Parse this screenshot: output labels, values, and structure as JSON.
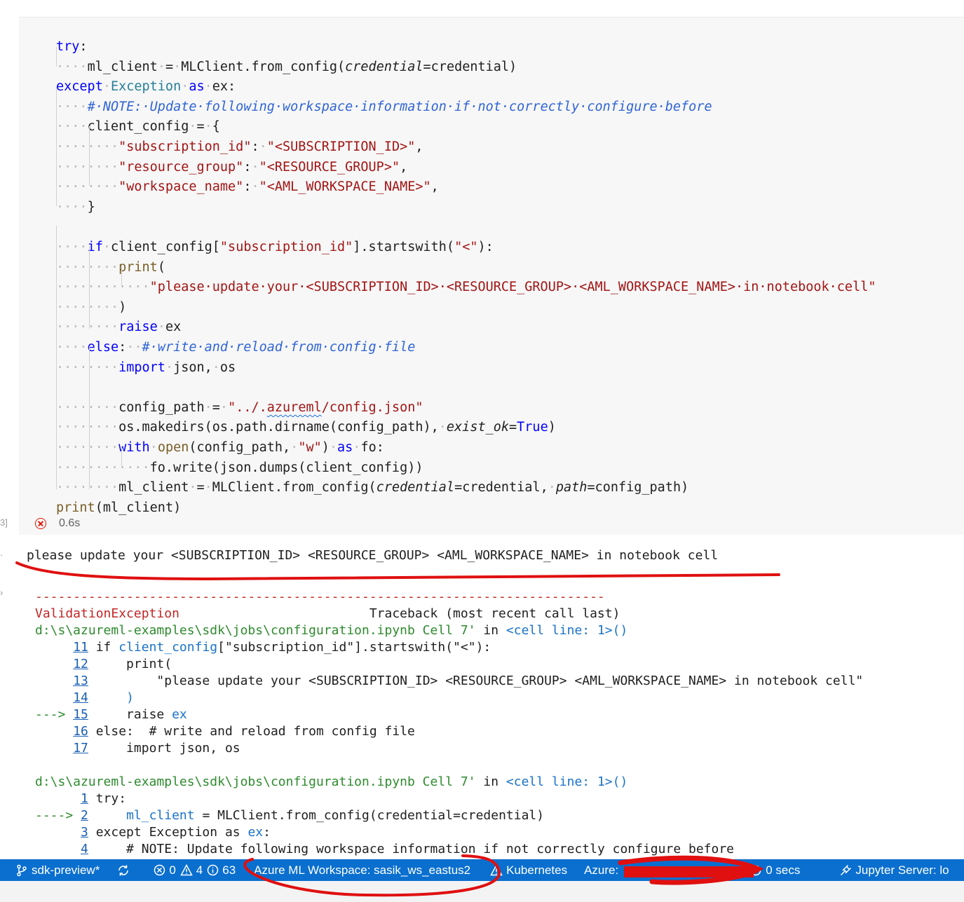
{
  "code_lines": [
    [
      {
        "t": "try",
        "c": "kw"
      },
      {
        "t": ":",
        "c": ""
      }
    ],
    [
      {
        "t": "····",
        "c": "dot"
      },
      {
        "t": "ml_client",
        "c": ""
      },
      {
        "t": "·",
        "c": "dot"
      },
      {
        "t": "=",
        "c": ""
      },
      {
        "t": "·",
        "c": "dot"
      },
      {
        "t": "MLClient.from_config(",
        "c": ""
      },
      {
        "t": "credential",
        "c": "param"
      },
      {
        "t": "=credential)",
        "c": ""
      }
    ],
    [
      {
        "t": "except",
        "c": "kw"
      },
      {
        "t": "·",
        "c": "dot"
      },
      {
        "t": "Exception",
        "c": "cls"
      },
      {
        "t": "·",
        "c": "dot"
      },
      {
        "t": "as",
        "c": "kw"
      },
      {
        "t": "·",
        "c": "dot"
      },
      {
        "t": "ex:",
        "c": ""
      }
    ],
    [
      {
        "t": "····",
        "c": "dot"
      },
      {
        "t": "#·NOTE:·Update·following·workspace·information·if·not·correctly·configure·before",
        "c": "cm"
      }
    ],
    [
      {
        "t": "····",
        "c": "dot"
      },
      {
        "t": "client_config",
        "c": ""
      },
      {
        "t": "·",
        "c": "dot"
      },
      {
        "t": "=",
        "c": ""
      },
      {
        "t": "·",
        "c": "dot"
      },
      {
        "t": "{",
        "c": ""
      }
    ],
    [
      {
        "t": "········",
        "c": "dot"
      },
      {
        "t": "\"subscription_id\"",
        "c": "str"
      },
      {
        "t": ":",
        "c": ""
      },
      {
        "t": "·",
        "c": "dot"
      },
      {
        "t": "\"<SUBSCRIPTION_ID>\"",
        "c": "str"
      },
      {
        "t": ",",
        "c": ""
      }
    ],
    [
      {
        "t": "········",
        "c": "dot"
      },
      {
        "t": "\"resource_group\"",
        "c": "str"
      },
      {
        "t": ":",
        "c": ""
      },
      {
        "t": "·",
        "c": "dot"
      },
      {
        "t": "\"<RESOURCE_GROUP>\"",
        "c": "str"
      },
      {
        "t": ",",
        "c": ""
      }
    ],
    [
      {
        "t": "········",
        "c": "dot"
      },
      {
        "t": "\"workspace_name\"",
        "c": "str"
      },
      {
        "t": ":",
        "c": ""
      },
      {
        "t": "·",
        "c": "dot"
      },
      {
        "t": "\"<AML_WORKSPACE_NAME>\"",
        "c": "str"
      },
      {
        "t": ",",
        "c": ""
      }
    ],
    [
      {
        "t": "····",
        "c": "dot"
      },
      {
        "t": "}",
        "c": ""
      }
    ],
    [],
    [
      {
        "t": "····",
        "c": "dot"
      },
      {
        "t": "if",
        "c": "kw"
      },
      {
        "t": "·",
        "c": "dot"
      },
      {
        "t": "client_config[",
        "c": ""
      },
      {
        "t": "\"subscription_id\"",
        "c": "str"
      },
      {
        "t": "].startswith(",
        "c": ""
      },
      {
        "t": "\"<\"",
        "c": "str"
      },
      {
        "t": "):",
        "c": ""
      }
    ],
    [
      {
        "t": "········",
        "c": "dot"
      },
      {
        "t": "print",
        "c": "fn"
      },
      {
        "t": "(",
        "c": ""
      }
    ],
    [
      {
        "t": "············",
        "c": "dot"
      },
      {
        "t": "\"please·update·your·<SUBSCRIPTION_ID>·<RESOURCE_GROUP>·<AML_WORKSPACE_NAME>·in·notebook·cell\"",
        "c": "str"
      }
    ],
    [
      {
        "t": "········",
        "c": "dot"
      },
      {
        "t": ")",
        "c": ""
      }
    ],
    [
      {
        "t": "········",
        "c": "dot"
      },
      {
        "t": "raise",
        "c": "kw"
      },
      {
        "t": "·",
        "c": "dot"
      },
      {
        "t": "ex",
        "c": ""
      }
    ],
    [
      {
        "t": "····",
        "c": "dot"
      },
      {
        "t": "else",
        "c": "kw"
      },
      {
        "t": ":",
        "c": ""
      },
      {
        "t": "··",
        "c": "dot"
      },
      {
        "t": "#·write·and·reload·from·config·file",
        "c": "cm"
      }
    ],
    [
      {
        "t": "········",
        "c": "dot"
      },
      {
        "t": "import",
        "c": "kw"
      },
      {
        "t": "·",
        "c": "dot"
      },
      {
        "t": "json,",
        "c": ""
      },
      {
        "t": "·",
        "c": "dot"
      },
      {
        "t": "os",
        "c": ""
      }
    ],
    [],
    [
      {
        "t": "········",
        "c": "dot"
      },
      {
        "t": "config_path",
        "c": ""
      },
      {
        "t": "·",
        "c": "dot"
      },
      {
        "t": "=",
        "c": ""
      },
      {
        "t": "·",
        "c": "dot"
      },
      {
        "t": "\"../.",
        "c": "str"
      },
      {
        "t": "azureml",
        "c": "str squig"
      },
      {
        "t": "/config.json\"",
        "c": "str"
      }
    ],
    [
      {
        "t": "········",
        "c": "dot"
      },
      {
        "t": "os.makedirs(os.path.dirname(config_path),",
        "c": ""
      },
      {
        "t": "·",
        "c": "dot"
      },
      {
        "t": "exist_ok",
        "c": "param"
      },
      {
        "t": "=",
        "c": ""
      },
      {
        "t": "True",
        "c": "kw"
      },
      {
        "t": ")",
        "c": ""
      }
    ],
    [
      {
        "t": "········",
        "c": "dot"
      },
      {
        "t": "with",
        "c": "kw"
      },
      {
        "t": "·",
        "c": "dot"
      },
      {
        "t": "open",
        "c": "fn"
      },
      {
        "t": "(config_path,",
        "c": ""
      },
      {
        "t": "·",
        "c": "dot"
      },
      {
        "t": "\"w\"",
        "c": "str"
      },
      {
        "t": ")",
        "c": ""
      },
      {
        "t": "·",
        "c": "dot"
      },
      {
        "t": "as",
        "c": "kw"
      },
      {
        "t": "·",
        "c": "dot"
      },
      {
        "t": "fo:",
        "c": ""
      }
    ],
    [
      {
        "t": "············",
        "c": "dot"
      },
      {
        "t": "fo.write(json.dumps(client_config))",
        "c": ""
      }
    ],
    [
      {
        "t": "········",
        "c": "dot"
      },
      {
        "t": "ml_client",
        "c": ""
      },
      {
        "t": "·",
        "c": "dot"
      },
      {
        "t": "=",
        "c": ""
      },
      {
        "t": "·",
        "c": "dot"
      },
      {
        "t": "MLClient.from_config(",
        "c": ""
      },
      {
        "t": "credential",
        "c": "param"
      },
      {
        "t": "=credential,",
        "c": ""
      },
      {
        "t": "·",
        "c": "dot"
      },
      {
        "t": "path",
        "c": "param"
      },
      {
        "t": "=config_path)",
        "c": ""
      }
    ],
    [
      {
        "t": "print",
        "c": "fn"
      },
      {
        "t": "(ml_client)",
        "c": ""
      }
    ]
  ],
  "exec": {
    "bracket": "3]",
    "duration": "0.6s"
  },
  "output": {
    "stdout": "please update your <SUBSCRIPTION_ID> <RESOURCE_GROUP> <AML_WORKSPACE_NAME> in notebook cell",
    "dashes": "---------------------------------------------------------------------------"
  },
  "traceback": [
    [
      {
        "t": "ValidationException",
        "c": "red"
      },
      {
        "t": "                         Traceback (most recent call last)",
        "c": ""
      }
    ],
    [
      {
        "t": "d:\\s\\azureml-examples\\sdk\\jobs\\configuration.ipynb Cell 7'",
        "c": "grn"
      },
      {
        "t": " in ",
        "c": ""
      },
      {
        "t": "<cell line: 1>()",
        "c": "blu"
      }
    ],
    [
      {
        "t": "     ",
        "c": ""
      },
      {
        "t": "11",
        "c": "lnk"
      },
      {
        "t": " if ",
        "c": ""
      },
      {
        "t": "client_config",
        "c": "blu"
      },
      {
        "t": "[\"subscription_id\"].startswith(\"<\"):",
        "c": ""
      }
    ],
    [
      {
        "t": "     ",
        "c": ""
      },
      {
        "t": "12",
        "c": "lnk"
      },
      {
        "t": "     print(",
        "c": ""
      }
    ],
    [
      {
        "t": "     ",
        "c": ""
      },
      {
        "t": "13",
        "c": "lnk"
      },
      {
        "t": "         \"please update your <SUBSCRIPTION_ID> <RESOURCE_GROUP> <AML_WORKSPACE_NAME> in notebook cell\"",
        "c": ""
      }
    ],
    [
      {
        "t": "     ",
        "c": ""
      },
      {
        "t": "14",
        "c": "lnk"
      },
      {
        "t": "     ",
        "c": ""
      },
      {
        "t": ")",
        "c": "blu"
      }
    ],
    [
      {
        "t": "---> ",
        "c": "grn"
      },
      {
        "t": "15",
        "c": "lnk"
      },
      {
        "t": "     raise ",
        "c": ""
      },
      {
        "t": "ex",
        "c": "blu"
      }
    ],
    [
      {
        "t": "     ",
        "c": ""
      },
      {
        "t": "16",
        "c": "lnk"
      },
      {
        "t": " else:  # write and reload from config file",
        "c": ""
      }
    ],
    [
      {
        "t": "     ",
        "c": ""
      },
      {
        "t": "17",
        "c": "lnk"
      },
      {
        "t": "     import json, os",
        "c": ""
      }
    ],
    [],
    [
      {
        "t": "d:\\s\\azureml-examples\\sdk\\jobs\\configuration.ipynb Cell 7'",
        "c": "grn"
      },
      {
        "t": " in ",
        "c": ""
      },
      {
        "t": "<cell line: 1>()",
        "c": "blu"
      }
    ],
    [
      {
        "t": "      ",
        "c": ""
      },
      {
        "t": "1",
        "c": "lnk"
      },
      {
        "t": " try:",
        "c": ""
      }
    ],
    [
      {
        "t": "----> ",
        "c": "grn"
      },
      {
        "t": "2",
        "c": "lnk"
      },
      {
        "t": "     ",
        "c": ""
      },
      {
        "t": "ml_client",
        "c": "blu"
      },
      {
        "t": " = MLClient.from_config(credential=credential)",
        "c": ""
      }
    ],
    [
      {
        "t": "      ",
        "c": ""
      },
      {
        "t": "3",
        "c": "lnk"
      },
      {
        "t": " except Exception as ",
        "c": ""
      },
      {
        "t": "ex",
        "c": "blu"
      },
      {
        "t": ":",
        "c": ""
      }
    ],
    [
      {
        "t": "      ",
        "c": ""
      },
      {
        "t": "4",
        "c": "lnk"
      },
      {
        "t": "     # NOTE: Update following workspace information if not correctly configure before",
        "c": ""
      }
    ]
  ],
  "status": {
    "branch": "sdk-preview*",
    "errors": "0",
    "warnings": "4",
    "infos": "63",
    "workspace": "Azure ML Workspace: sasik_ws_eastus2",
    "kubernetes": "Kubernetes",
    "azure": "Azure:",
    "timer": "0 secs",
    "jupyter": "Jupyter Server: lo"
  },
  "colors": {
    "status_bar": "#0a6fcf",
    "annotation": "#e01010",
    "error": "#e51400"
  }
}
